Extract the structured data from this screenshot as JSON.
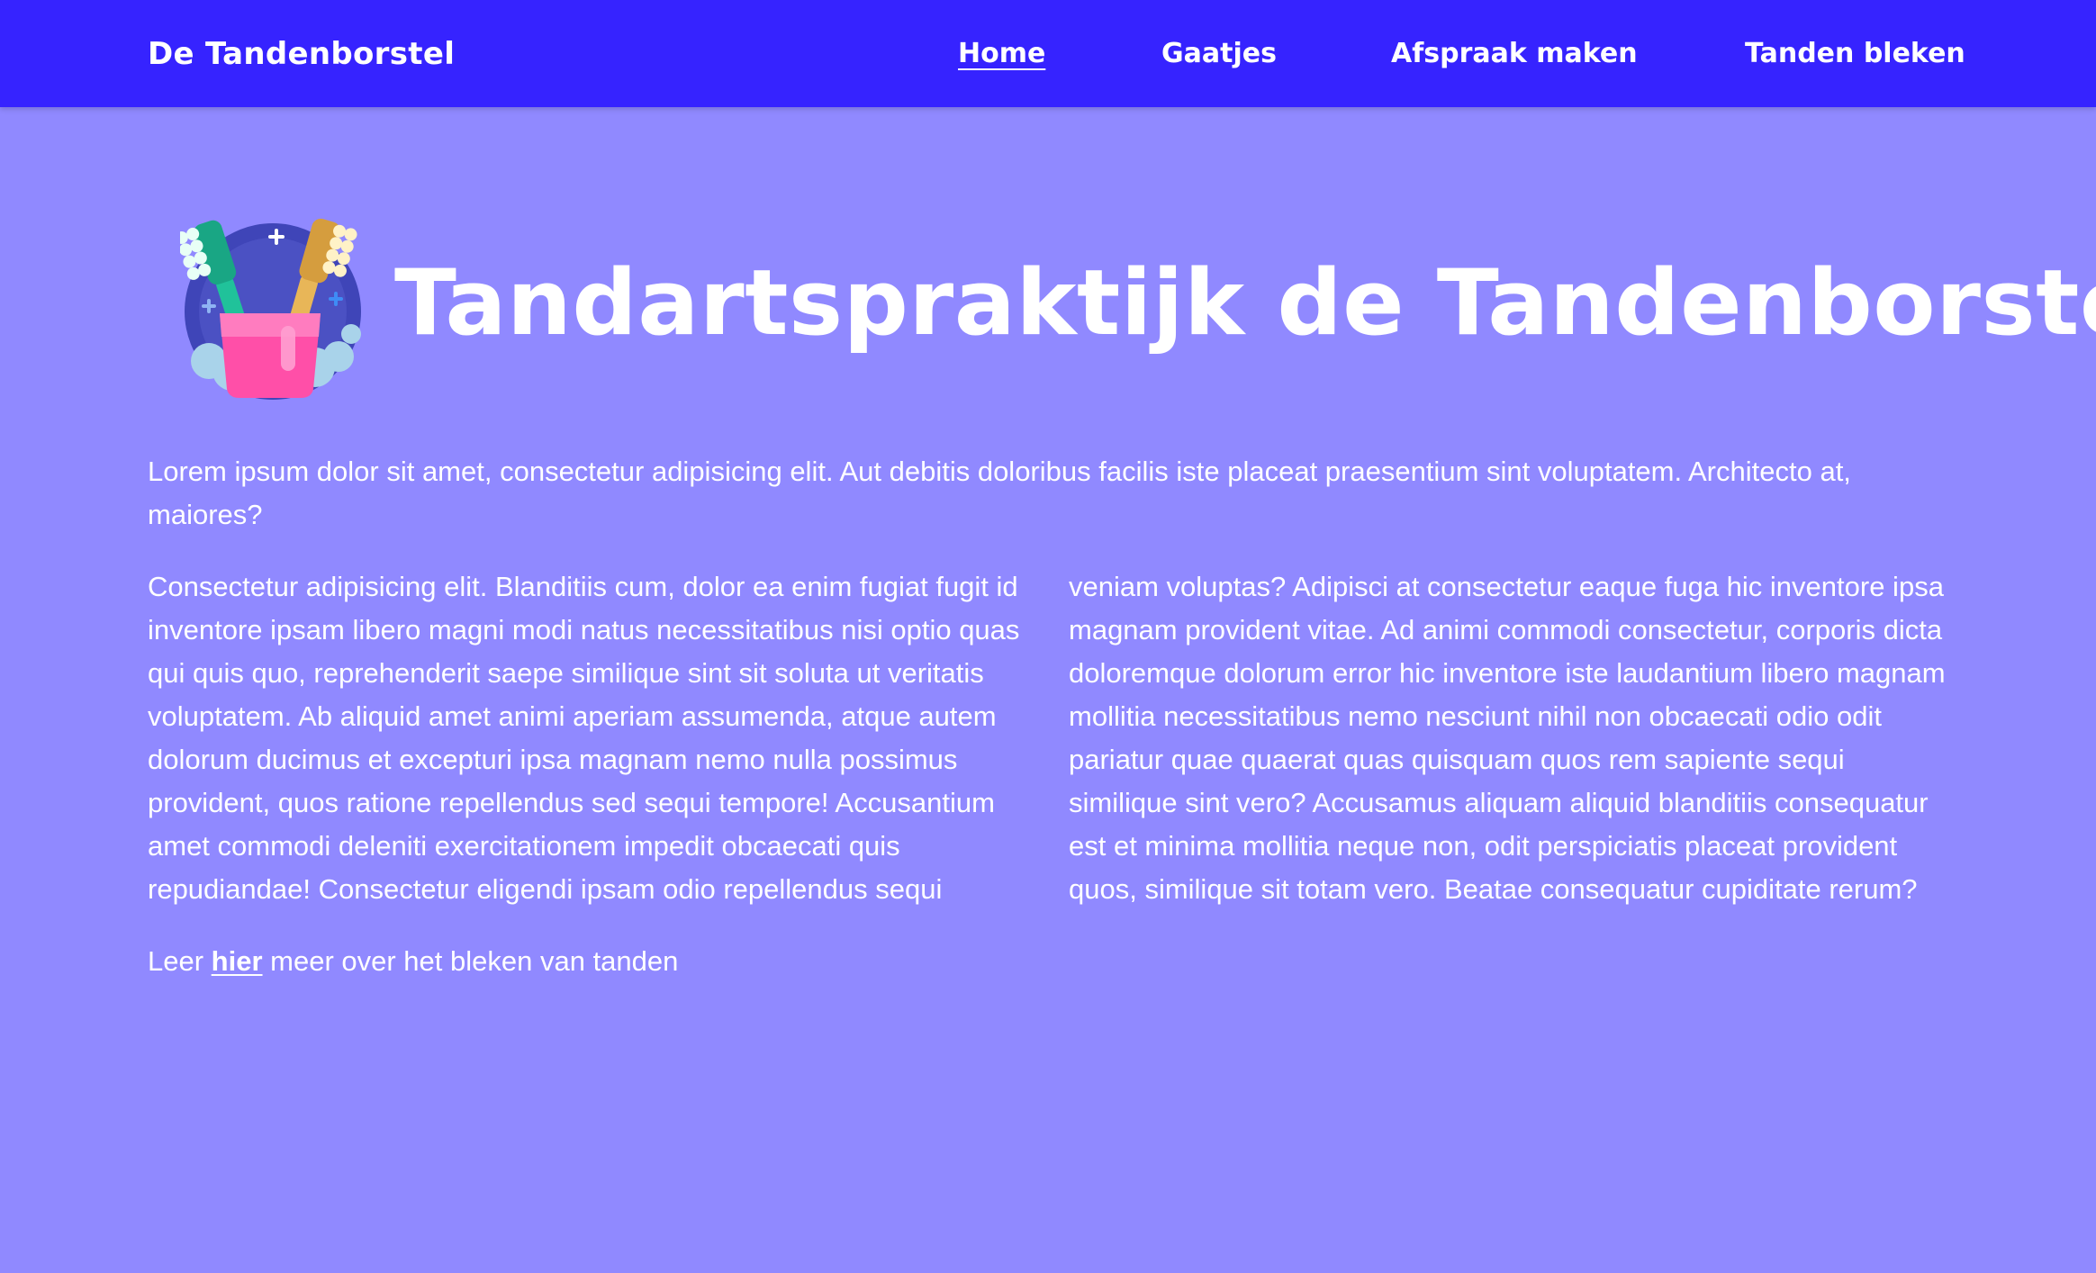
{
  "nav": {
    "brand": "De Tandenborstel",
    "links": [
      {
        "label": "Home",
        "active": true
      },
      {
        "label": "Gaatjes",
        "active": false
      },
      {
        "label": "Afspraak maken",
        "active": false
      },
      {
        "label": "Tanden bleken",
        "active": false
      }
    ]
  },
  "hero": {
    "logo_icon": "toothbrush-cup-icon",
    "title": "Tandartspraktijk de Tandenborstel"
  },
  "content": {
    "intro": "Lorem ipsum dolor sit amet, consectetur adipisicing elit. Aut debitis doloribus facilis iste placeat praesentium sint voluptatem. Architecto at, maiores?",
    "body": "Consectetur adipisicing elit. Blanditiis cum, dolor ea enim fugiat fugit id inventore ipsam libero magni modi natus necessitatibus nisi optio quas qui quis quo, reprehenderit saepe similique sint sit soluta ut veritatis voluptatem. Ab aliquid amet animi aperiam assumenda, atque autem dolorum ducimus et excepturi ipsa magnam nemo nulla possimus provident, quos ratione repellendus sed sequi tempore! Accusantium amet commodi deleniti exercitationem impedit obcaecati quis repudiandae! Consectetur eligendi ipsam odio repellendus sequi veniam voluptas? Adipisci at consectetur eaque fuga hic inventore ipsa magnam provident vitae. Ad animi commodi consectetur, corporis dicta doloremque dolorum error hic inventore iste laudantium libero magnam mollitia necessitatibus nemo nesciunt nihil non obcaecati odio odit pariatur quae quaerat quas quisquam quos rem sapiente sequi similique sint vero? Accusamus aliquam aliquid blanditiis consequatur est et minima mollitia neque non, odit perspiciatis placeat provident quos, similique sit totam vero. Beatae consequatur cupiditate rerum?",
    "learn_more": {
      "prefix": "Leer ",
      "link_label": "hier",
      "suffix": " meer over het bleken van tanden"
    }
  },
  "colors": {
    "navbar_bg": "#3623ff",
    "page_bg": "#9089ff",
    "text": "#ffffff"
  }
}
